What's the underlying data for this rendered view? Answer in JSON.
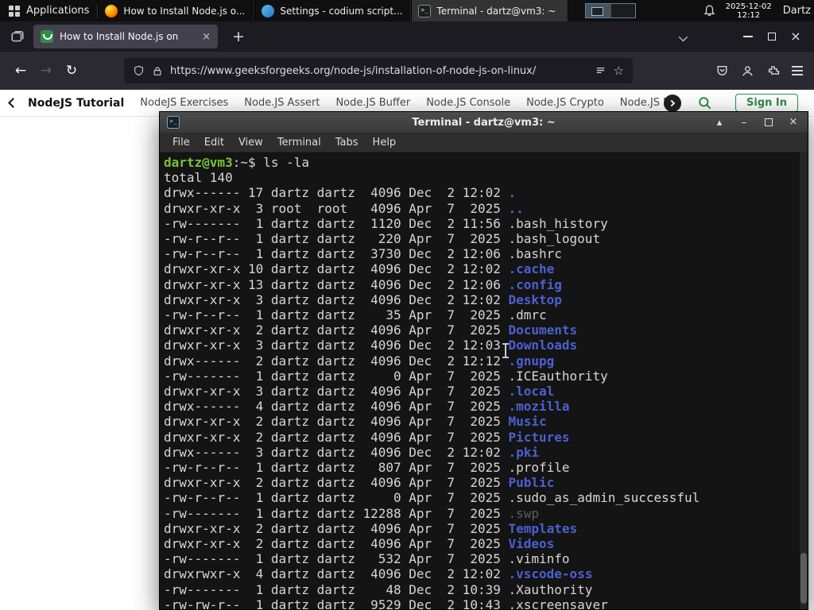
{
  "colors": {
    "terminal_green": "#77c43a",
    "terminal_blue": "#4b60d2",
    "terminal_dim": "#5e5e5e",
    "gfg_green": "#2f8d46",
    "panel_bg": "#0f0f0f",
    "firefox_tab_bg": "#42414d",
    "terminal_bg": "#141414"
  },
  "icons": {
    "new_tab": "+",
    "close": "×",
    "minimize": "–",
    "back": "←",
    "forward": "→",
    "reload": "↻",
    "star": "☆",
    "shade": "▴"
  },
  "panel": {
    "applications_label": "Applications",
    "taskbar": [
      {
        "title": "How to Install Node.js o...",
        "icon": "firefox",
        "active": false
      },
      {
        "title": "Settings - codium script...",
        "icon": "vscodium",
        "active": false
      },
      {
        "title": "Terminal - dartz@vm3: ~",
        "icon": "terminal",
        "active": true
      }
    ],
    "clock": {
      "date": "2025-12-02",
      "time": "12:12"
    },
    "user": "Dartz"
  },
  "browser": {
    "tab": {
      "title": "How to Install Node.js on"
    },
    "url": "https://www.geeksforgeeks.org/node-js/installation-of-node-js-on-linux/"
  },
  "site_header": {
    "primary": "NodeJS Tutorial",
    "links": [
      "NodeJS Exercises",
      "Node.JS Assert",
      "Node.JS Buffer",
      "Node.JS Console",
      "Node.JS Crypto",
      "Node.JS DNS",
      "Node..."
    ],
    "sign_in": "Sign In"
  },
  "terminal": {
    "title": "Terminal - dartz@vm3: ~",
    "menu": [
      "File",
      "Edit",
      "View",
      "Terminal",
      "Tabs",
      "Help"
    ],
    "lines": [
      [
        {
          "t": "dartz@vm3",
          "c": "green"
        },
        {
          "t": ":~$ ls -la",
          "c": "fg"
        }
      ],
      [
        {
          "t": "total 140",
          "c": "fg"
        }
      ],
      [
        {
          "t": "drwx------ 17 dartz dartz  4096 Dec  2 12:02 ",
          "c": "fg"
        },
        {
          "t": ".",
          "c": "blue"
        }
      ],
      [
        {
          "t": "drwxr-xr-x  3 root  root   4096 Apr  7  2025 ",
          "c": "fg"
        },
        {
          "t": "..",
          "c": "blue"
        }
      ],
      [
        {
          "t": "-rw-------  1 dartz dartz  1120 Dec  2 11:56 .bash_history",
          "c": "fg"
        }
      ],
      [
        {
          "t": "-rw-r--r--  1 dartz dartz   220 Apr  7  2025 .bash_logout",
          "c": "fg"
        }
      ],
      [
        {
          "t": "-rw-r--r--  1 dartz dartz  3730 Dec  2 12:06 .bashrc",
          "c": "fg"
        }
      ],
      [
        {
          "t": "drwxr-xr-x 10 dartz dartz  4096 Dec  2 12:02 ",
          "c": "fg"
        },
        {
          "t": ".cache",
          "c": "blue"
        }
      ],
      [
        {
          "t": "drwxr-xr-x 13 dartz dartz  4096 Dec  2 12:06 ",
          "c": "fg"
        },
        {
          "t": ".config",
          "c": "blue"
        }
      ],
      [
        {
          "t": "drwxr-xr-x  3 dartz dartz  4096 Dec  2 12:02 ",
          "c": "fg"
        },
        {
          "t": "Desktop",
          "c": "blue"
        }
      ],
      [
        {
          "t": "-rw-r--r--  1 dartz dartz    35 Apr  7  2025 .dmrc",
          "c": "fg"
        }
      ],
      [
        {
          "t": "drwxr-xr-x  2 dartz dartz  4096 Apr  7  2025 ",
          "c": "fg"
        },
        {
          "t": "Documents",
          "c": "blue"
        }
      ],
      [
        {
          "t": "drwxr-xr-x  3 dartz dartz  4096 Dec  2 12:03 ",
          "c": "fg"
        },
        {
          "t": "Downloads",
          "c": "blue"
        }
      ],
      [
        {
          "t": "drwx------  2 dartz dartz  4096 Dec  2 12:12 ",
          "c": "fg"
        },
        {
          "t": ".gnupg",
          "c": "blue"
        }
      ],
      [
        {
          "t": "-rw-------  1 dartz dartz     0 Apr  7  2025 .ICEauthority",
          "c": "fg"
        }
      ],
      [
        {
          "t": "drwxr-xr-x  3 dartz dartz  4096 Apr  7  2025 ",
          "c": "fg"
        },
        {
          "t": ".local",
          "c": "blue"
        }
      ],
      [
        {
          "t": "drwx------  4 dartz dartz  4096 Apr  7  2025 ",
          "c": "fg"
        },
        {
          "t": ".mozilla",
          "c": "blue"
        }
      ],
      [
        {
          "t": "drwxr-xr-x  2 dartz dartz  4096 Apr  7  2025 ",
          "c": "fg"
        },
        {
          "t": "Music",
          "c": "blue"
        }
      ],
      [
        {
          "t": "drwxr-xr-x  2 dartz dartz  4096 Apr  7  2025 ",
          "c": "fg"
        },
        {
          "t": "Pictures",
          "c": "blue"
        }
      ],
      [
        {
          "t": "drwx------  3 dartz dartz  4096 Dec  2 12:02 ",
          "c": "fg"
        },
        {
          "t": ".pki",
          "c": "blue"
        }
      ],
      [
        {
          "t": "-rw-r--r--  1 dartz dartz   807 Apr  7  2025 .profile",
          "c": "fg"
        }
      ],
      [
        {
          "t": "drwxr-xr-x  2 dartz dartz  4096 Apr  7  2025 ",
          "c": "fg"
        },
        {
          "t": "Public",
          "c": "blue"
        }
      ],
      [
        {
          "t": "-rw-r--r--  1 dartz dartz     0 Apr  7  2025 .sudo_as_admin_successful",
          "c": "fg"
        }
      ],
      [
        {
          "t": "-rw-------  1 dartz dartz 12288 Apr  7  2025 ",
          "c": "fg"
        },
        {
          "t": ".swp",
          "c": "dim"
        }
      ],
      [
        {
          "t": "drwxr-xr-x  2 dartz dartz  4096 Apr  7  2025 ",
          "c": "fg"
        },
        {
          "t": "Templates",
          "c": "blue"
        }
      ],
      [
        {
          "t": "drwxr-xr-x  2 dartz dartz  4096 Apr  7  2025 ",
          "c": "fg"
        },
        {
          "t": "Videos",
          "c": "blue"
        }
      ],
      [
        {
          "t": "-rw-------  1 dartz dartz   532 Apr  7  2025 .viminfo",
          "c": "fg"
        }
      ],
      [
        {
          "t": "drwxrwxr-x  4 dartz dartz  4096 Dec  2 12:02 ",
          "c": "fg"
        },
        {
          "t": ".vscode-oss",
          "c": "blue"
        }
      ],
      [
        {
          "t": "-rw-------  1 dartz dartz    48 Dec  2 10:39 .Xauthority",
          "c": "fg"
        }
      ],
      [
        {
          "t": "-rw-rw-r--  1 dartz dartz  9529 Dec  2 10:43 .xscreensaver",
          "c": "fg"
        }
      ]
    ]
  }
}
